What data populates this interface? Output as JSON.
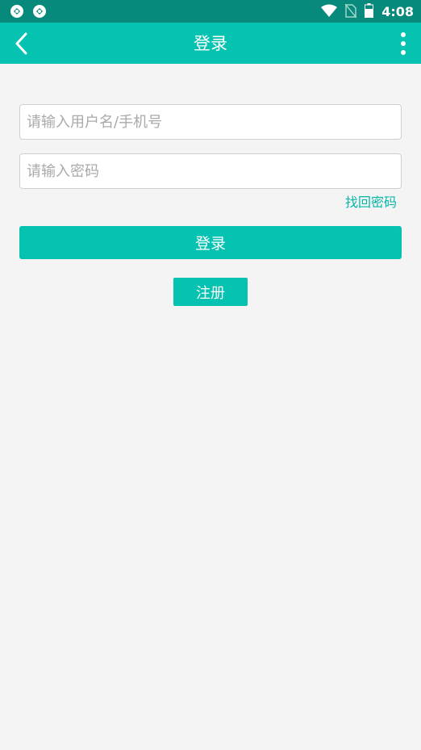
{
  "status_bar": {
    "time": "4:08",
    "icons": [
      "notification-icon",
      "notification-icon",
      "wifi-icon",
      "no-sim-icon",
      "battery-icon"
    ]
  },
  "app_bar": {
    "title": "登录",
    "back_icon": "back-arrow-icon",
    "more_icon": "overflow-menu-icon"
  },
  "form": {
    "username_placeholder": "请输入用户名/手机号",
    "password_placeholder": "请输入密码",
    "forgot_password": "找回密码",
    "login_label": "登录",
    "register_label": "注册"
  },
  "colors": {
    "status_bar": "#07897b",
    "accent": "#05c2b1",
    "link": "#05b7a7",
    "background": "#f4f4f4"
  }
}
